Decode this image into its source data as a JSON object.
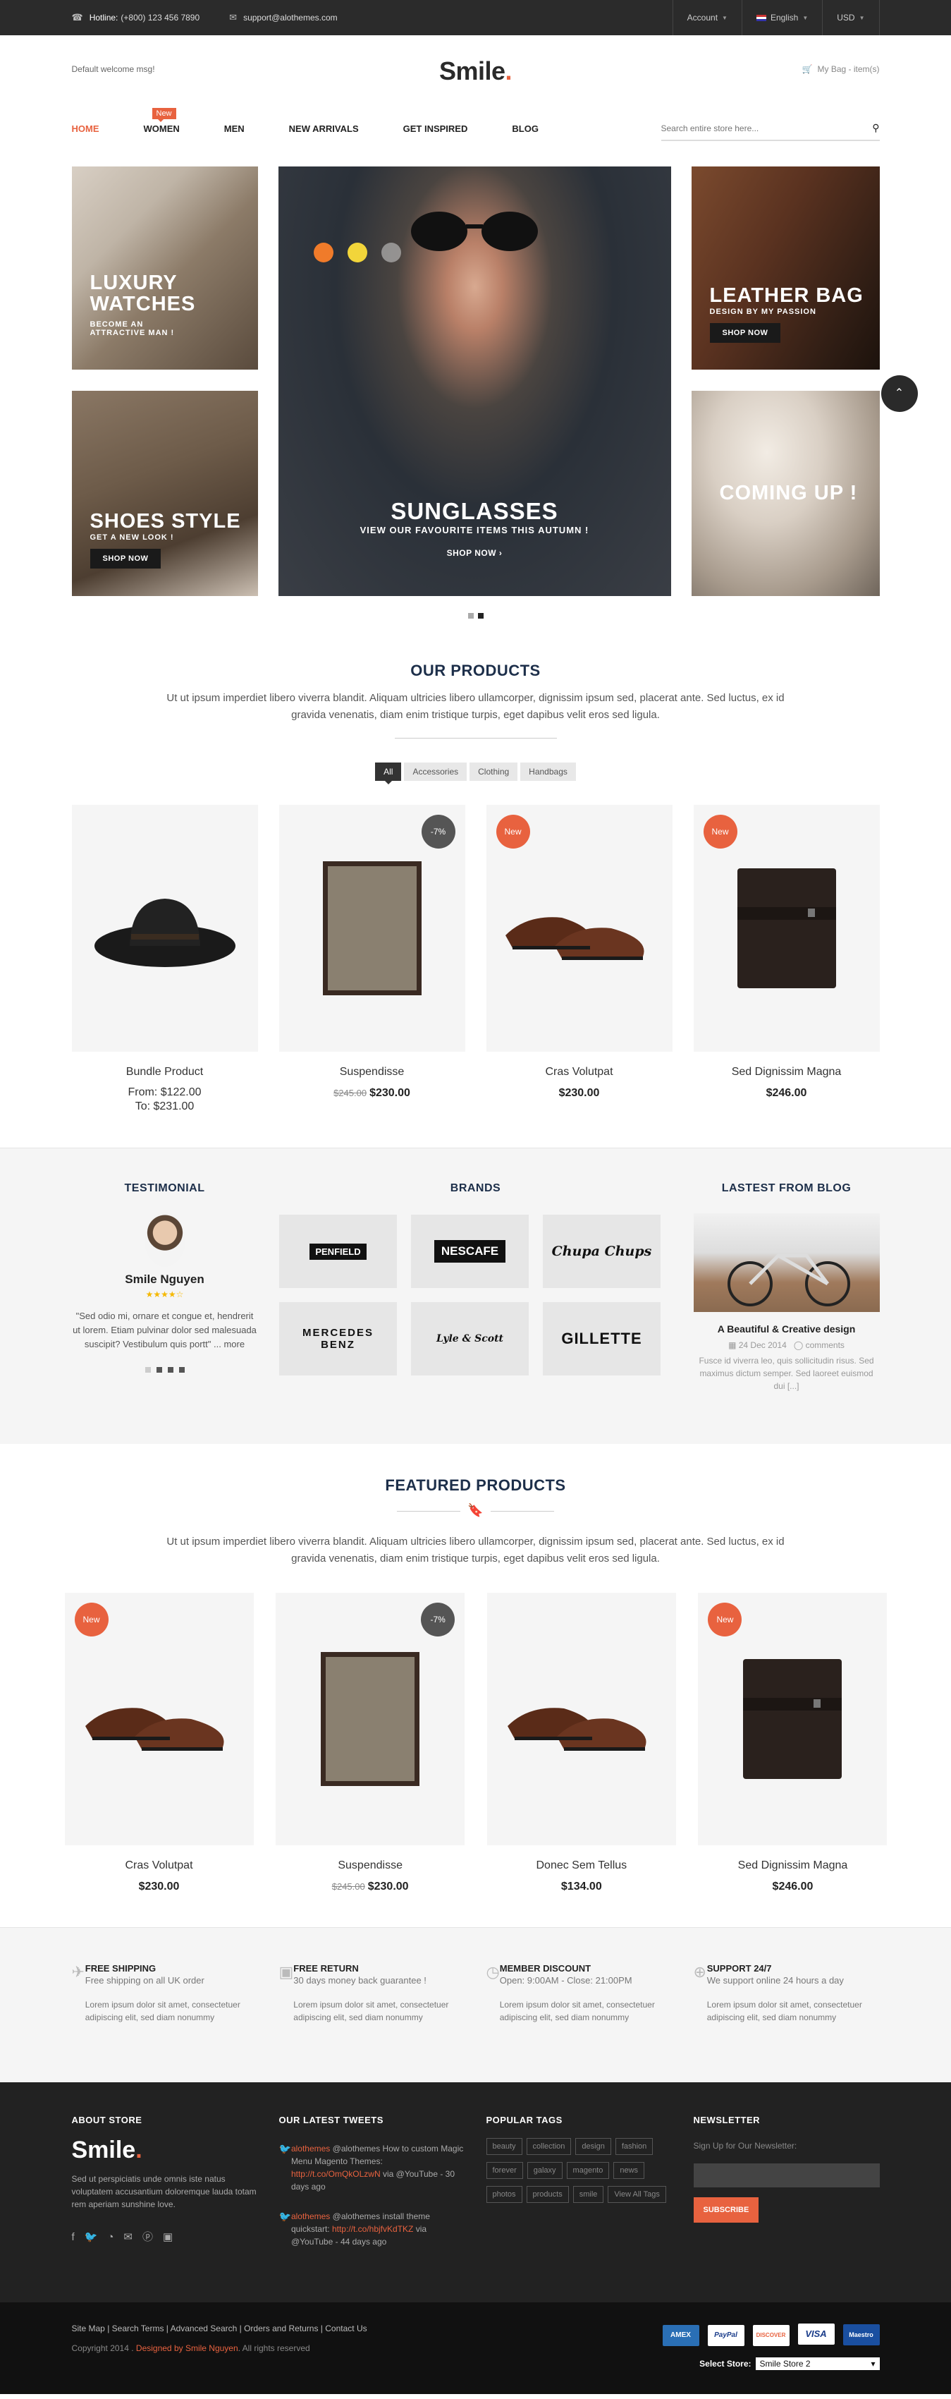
{
  "topbar": {
    "hotline_label": "Hotline:",
    "hotline": "(+800) 123 456 7890",
    "email": "support@alothemes.com",
    "account": "Account",
    "language": "English",
    "currency": "USD"
  },
  "header": {
    "welcome": "Default welcome msg!",
    "logo": "Smile",
    "logo_dot": ".",
    "bag": "My Bag - item(s)"
  },
  "nav": {
    "items": [
      "HOME",
      "WOMEN",
      "MEN",
      "NEW ARRIVALS",
      "GET INSPIRED",
      "BLOG"
    ],
    "badge": "New",
    "search_placeholder": "Search entire store here..."
  },
  "banner": {
    "watches_title_1": "LUXURY",
    "watches_title_2": "WATCHES",
    "watches_sub_1": "BECOME AN",
    "watches_sub_2": "ATTRACTIVE MAN !",
    "shoes_title": "SHOES STYLE",
    "shoes_sub": "GET A NEW LOOK !",
    "shoes_btn": "SHOP NOW",
    "sunglasses_title": "SUNGLASSES",
    "sunglasses_sub": "VIEW OUR FAVOURITE ITEMS THIS AUTUMN !",
    "sunglasses_btn": "SHOP NOW ›",
    "leather_title": "LEATHER BAG",
    "leather_sub": "DESIGN BY MY PASSION",
    "leather_btn": "SHOP NOW",
    "coming_title": "COMING UP !"
  },
  "our_products": {
    "title": "OUR PRODUCTS",
    "desc": "Ut ut ipsum imperdiet libero viverra blandit. Aliquam ultricies libero ullamcorper, dignissim ipsum sed, placerat ante. Sed luctus, ex id gravida venenatis, diam enim tristique turpis, eget dapibus velit eros sed ligula.",
    "filters": [
      "All",
      "Accessories",
      "Clothing",
      "Handbags"
    ],
    "products": [
      {
        "name": "Bundle Product",
        "from": "From: $122.00",
        "to": "To: $231.00"
      },
      {
        "name": "Suspendisse",
        "old": "$245.00",
        "price": "$230.00",
        "tag": "-7%"
      },
      {
        "name": "Cras Volutpat",
        "price": "$230.00",
        "tag": "New"
      },
      {
        "name": "Sed Dignissim Magna",
        "price": "$246.00",
        "tag": "New"
      }
    ]
  },
  "testimonial": {
    "title": "TESTIMONIAL",
    "name": "Smile Nguyen",
    "stars": "★★★★☆",
    "quote": "\"Sed odio mi, ornare et congue et, hendrerit ut lorem. Etiam pulvinar dolor sed malesuada suscipit? Vestibulum quis portt\"",
    "more": "... more"
  },
  "brands": {
    "title": "BRANDS",
    "items": [
      "PENFIELD",
      "NESCAFE",
      "Chupa Chups",
      "MERCEDES BENZ",
      "Lyle & Scott",
      "GILLETTE"
    ]
  },
  "blog": {
    "title": "LASTEST FROM BLOG",
    "post_title": "A Beautiful & Creative design",
    "date": "24 Dec 2014",
    "comments": "comments",
    "excerpt": "Fusce id viverra leo, quis sollicitudin risus. Sed maximus dictum semper. Sed laoreet euismod dui [...]"
  },
  "featured": {
    "title": "FEATURED PRODUCTS",
    "desc": "Ut ut ipsum imperdiet libero viverra blandit. Aliquam ultricies libero ullamcorper, dignissim ipsum sed, placerat ante. Sed luctus, ex id gravida venenatis, diam enim tristique turpis, eget dapibus velit eros sed ligula.",
    "products": [
      {
        "name": "Cras Volutpat",
        "price": "$230.00",
        "tag": "New"
      },
      {
        "name": "Suspendisse",
        "old": "$245.00",
        "price": "$230.00",
        "tag": "-7%"
      },
      {
        "name": "Donec Sem Tellus",
        "price": "$134.00"
      },
      {
        "name": "Sed Dignissim Magna",
        "price": "$246.00",
        "tag": "New"
      }
    ]
  },
  "services": [
    {
      "title": "FREE SHIPPING",
      "sub": "Free shipping on all UK order",
      "text": "Lorem ipsum dolor sit amet, consectetuer adipiscing elit, sed diam nonummy"
    },
    {
      "title": "FREE RETURN",
      "sub": "30 days money back guarantee !",
      "text": "Lorem ipsum dolor sit amet, consectetuer adipiscing elit, sed diam nonummy"
    },
    {
      "title": "MEMBER DISCOUNT",
      "sub": "Open: 9:00AM - Close: 21:00PM",
      "text": "Lorem ipsum dolor sit amet, consectetuer adipiscing elit, sed diam nonummy"
    },
    {
      "title": "SUPPORT 24/7",
      "sub": "We support online 24 hours a day",
      "text": "Lorem ipsum dolor sit amet, consectetuer adipiscing elit, sed diam nonummy"
    }
  ],
  "footer": {
    "about_title": "ABOUT STORE",
    "about_text": "Sed ut perspiciatis unde omnis iste natus voluptatem accusantium doloremque lauda totam rem aperiam sunshine love.",
    "tweets_title": "OUR LATEST TWEETS",
    "tweet1_handle": "alothemes",
    "tweet1_at": "@alothemes",
    "tweet1_text": "How to custom Magic Menu Magento Themes:",
    "tweet1_link": "http://t.co/OmQkOLzwN",
    "tweet1_tail": "via @YouTube - 30 days ago",
    "tweet2_handle": "alothemes",
    "tweet2_at": "@alothemes",
    "tweet2_text": "install theme quickstart:",
    "tweet2_link": "http://t.co/hbjfvKdTKZ",
    "tweet2_tail": "via @YouTube - 44 days ago",
    "tags_title": "POPULAR TAGS",
    "tags": [
      "beauty",
      "collection",
      "design",
      "fashion",
      "forever",
      "galaxy",
      "magento",
      "news",
      "photos",
      "products",
      "smile",
      "View All Tags"
    ],
    "news_title": "NEWSLETTER",
    "news_sub": "Sign Up for Our Newsletter:",
    "news_btn": "SUBSCRIBE"
  },
  "bottom": {
    "links": "Site Map | Search Terms | Advanced Search | Orders and Returns | Contact Us",
    "copy": "Copyright 2014 .",
    "designed": "Designed by Smile Nguyen",
    "rights": ". All rights reserved",
    "cards": [
      "AMEX",
      "PayPal",
      "DISCOVER",
      "VISA",
      "Maestro"
    ],
    "store_label": "Select Store:",
    "store_value": "Smile Store 2"
  }
}
